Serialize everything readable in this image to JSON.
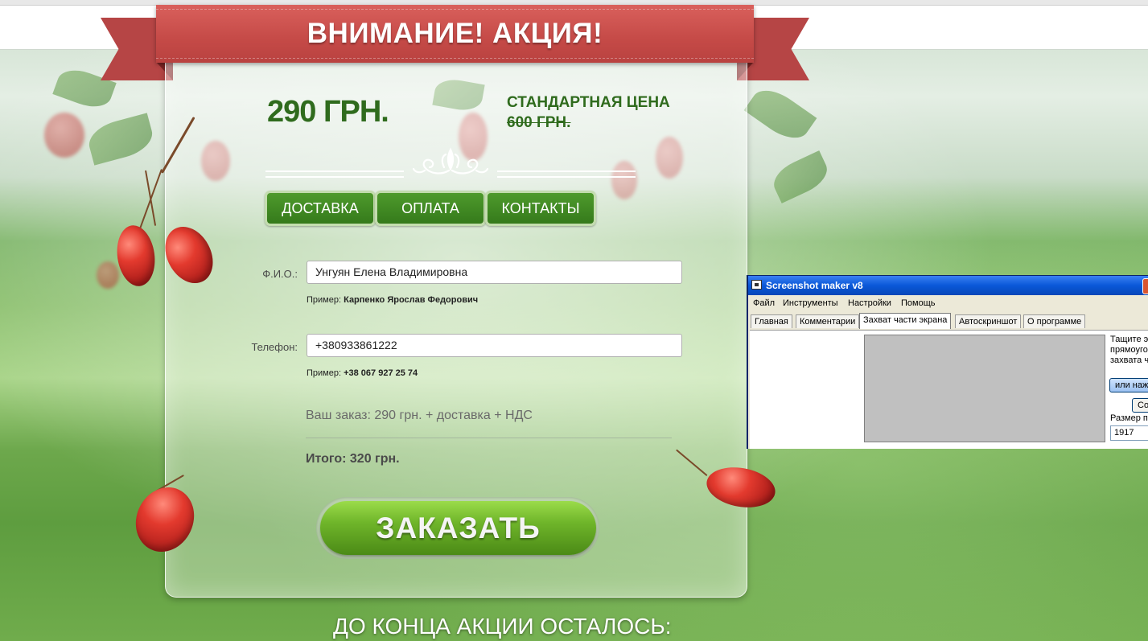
{
  "banner": {
    "title": "ВНИМАНИЕ! АКЦИЯ!"
  },
  "pricing": {
    "price": "290 ГРН.",
    "standard_label": "СТАНДАРТНАЯ ЦЕНА",
    "standard_price": "600 ГРН."
  },
  "nav": {
    "items": [
      {
        "label": "ДОСТАВКА"
      },
      {
        "label": "ОПЛАТА"
      },
      {
        "label": "КОНТАКТЫ"
      }
    ]
  },
  "form": {
    "name_label": "Ф.И.О.:",
    "name_value": "Унгуян Елена Владимировна",
    "name_hint_prefix": "Пример:",
    "name_hint_example": "Карпенко Ярослав Федорович",
    "phone_label": "Телефон:",
    "phone_value": "+380933861222",
    "phone_hint_prefix": "Пример:",
    "phone_hint_example": "+38 067 927 25 74",
    "order_summary": "Ваш заказ: 290 грн. + доставка + НДС",
    "total": "Итого: 320 грн.",
    "submit_label": "ЗАКАЗАТЬ"
  },
  "countdown": {
    "label": "ДО КОНЦА АКЦИИ ОСТАЛОСЬ:"
  },
  "screenshot_app": {
    "title": "Screenshot maker v8",
    "menu": [
      "Файл",
      "Инструменты",
      "Настройки",
      "Помощь"
    ],
    "tabs": [
      "Главная",
      "Комментарии",
      "Захват части экрана",
      "Автоскриншот",
      "О программе"
    ],
    "active_tab": "Захват части экрана",
    "side_text_1": "Тащите э",
    "side_text_2": "прямоуго",
    "side_text_3": "захвата ч",
    "button_1": "или наж",
    "button_2": "Сох",
    "size_label": "Размер по",
    "size_value": "1917"
  },
  "colors": {
    "ribbon": "#c54a47",
    "price_green": "#2f6b1d",
    "nav_green": "#3f8a22",
    "submit_green": "#6fb52a"
  }
}
